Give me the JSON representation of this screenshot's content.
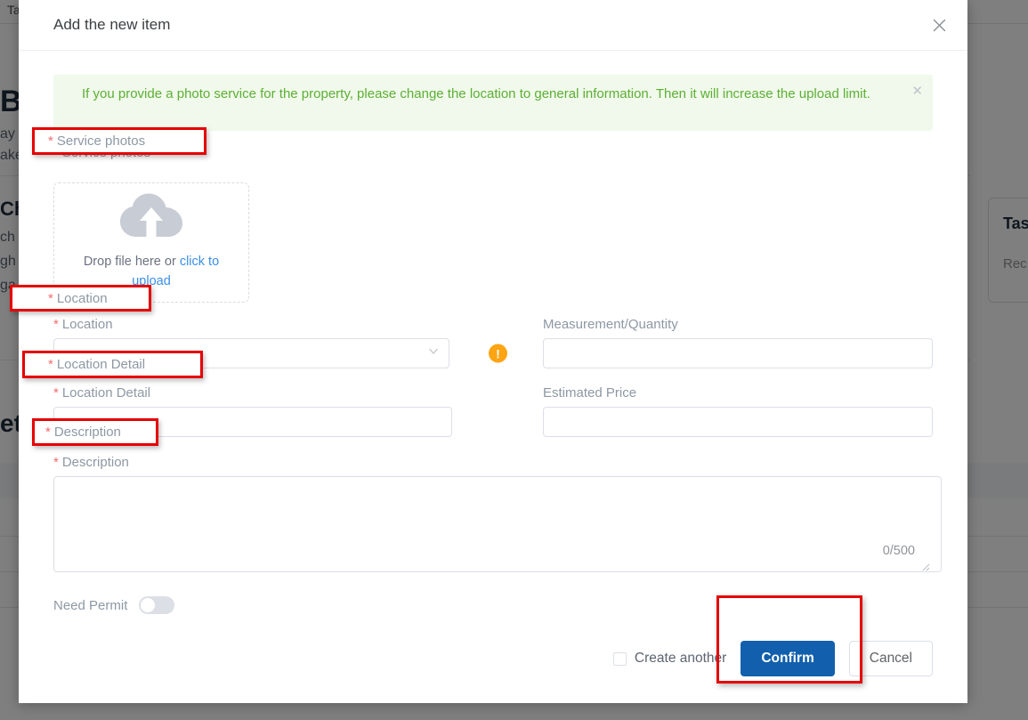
{
  "background": {
    "tab_label": "Ta",
    "heading": "Bo",
    "paragraph_lines": [
      "ay",
      "ake"
    ],
    "section_heading": "Ch",
    "section_lines": [
      "ch",
      "gh",
      "ga"
    ],
    "lower_heading": "et",
    "card": {
      "title": "Tas",
      "subtitle": "Rec"
    }
  },
  "modal": {
    "title": "Add the new item",
    "close_icon": "close-icon",
    "alert": {
      "text": "If you provide a photo service for the property, please change the location to general information. Then it will increase the upload limit.",
      "close_icon": "close-icon",
      "bg_color": "#f0f9eb",
      "text_color": "#5daf34"
    },
    "fields": {
      "service_photos": {
        "label": "Service photos",
        "required_marker": "*",
        "uploader": {
          "icon": "cloud-upload-icon",
          "text_prefix": "Drop file here or ",
          "link_text": "click to upload"
        }
      },
      "location": {
        "label": "Location",
        "required_marker": "*",
        "value": "--",
        "chevron_icon": "chevron-down-icon",
        "warning_icon": "exclamation-circle-icon",
        "warning_color": "#ffa412"
      },
      "measurement": {
        "label": "Measurement/Quantity",
        "value": "",
        "placeholder": ""
      },
      "location_detail": {
        "label": "Location Detail",
        "required_marker": "*",
        "value": "",
        "placeholder": ""
      },
      "estimated_price": {
        "label": "Estimated Price",
        "value": "",
        "placeholder": ""
      },
      "description": {
        "label": "Description",
        "required_marker": "*",
        "value": "",
        "placeholder": "",
        "counter": "0/500"
      },
      "need_permit": {
        "label": "Need Permit",
        "state": "off"
      }
    },
    "footer": {
      "create_another_label": "Create another",
      "create_another_checked": false,
      "confirm_label": "Confirm",
      "cancel_label": "Cancel",
      "confirm_color": "#1260ad"
    }
  },
  "annotations": {
    "color": "#e60000",
    "boxes": [
      "service-photos-label",
      "location-label",
      "location-detail-label",
      "description-label",
      "confirm-button"
    ]
  }
}
